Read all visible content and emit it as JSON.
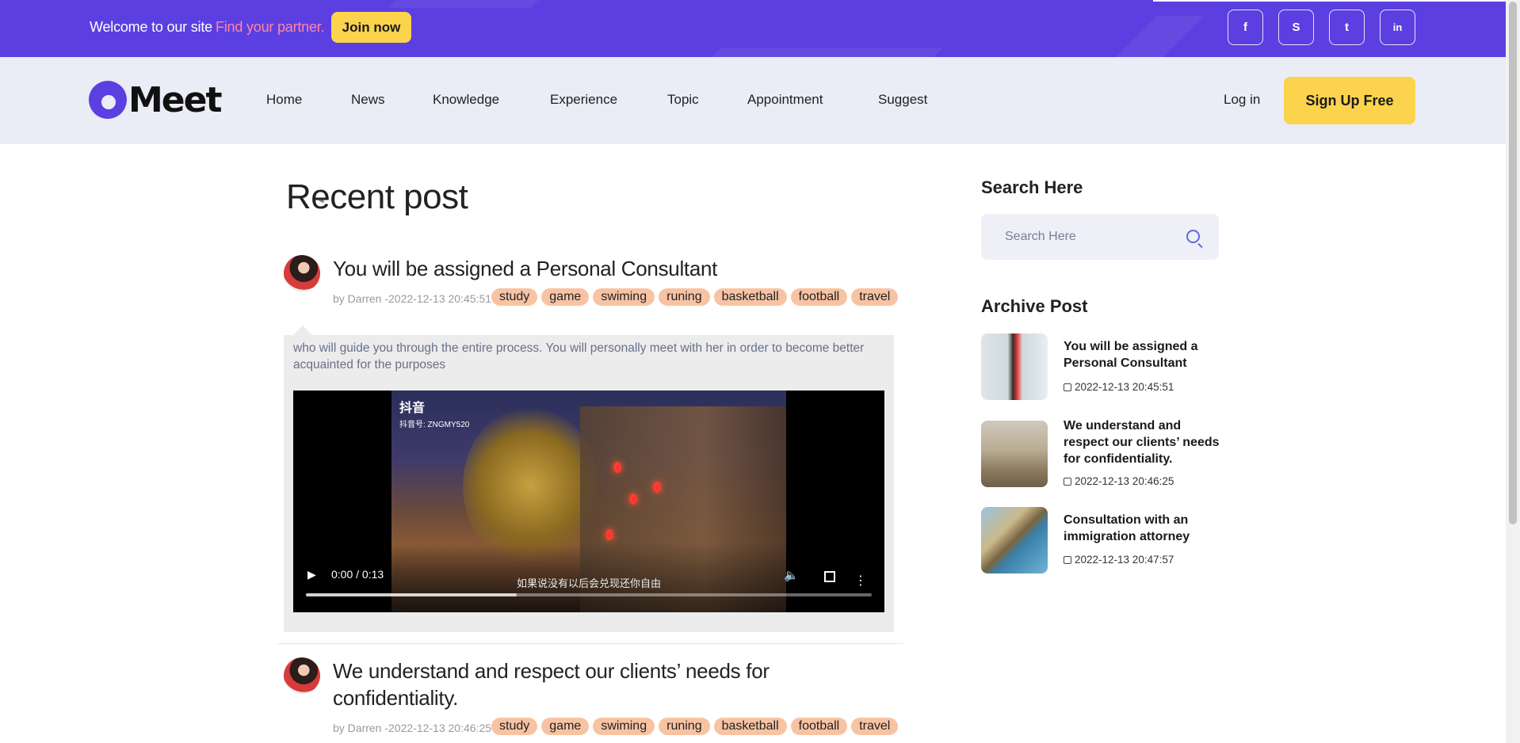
{
  "topbar": {
    "welcome": "Welcome to our site",
    "highlight": "Find your partner.",
    "join_label": "Join now",
    "social": [
      {
        "icon": "facebook-icon",
        "glyph": "f"
      },
      {
        "icon": "skype-icon",
        "glyph": "S"
      },
      {
        "icon": "twitter-icon",
        "glyph": "t"
      },
      {
        "icon": "linkedin-icon",
        "glyph": "in"
      }
    ],
    "colors": {
      "bar": "#5b3fe0",
      "accent": "#ff86a8",
      "button": "#fcd34d"
    }
  },
  "nav": {
    "logo_text": "Meet",
    "items": [
      "Home",
      "News",
      "Knowledge",
      "Experience",
      "Topic",
      "Appointment",
      "Suggest"
    ],
    "login": "Log in",
    "signup": "Sign Up Free"
  },
  "main": {
    "title": "Recent post",
    "posts": [
      {
        "title": "You will be assigned a Personal Consultant",
        "meta": "by Darren -2022-12-13 20:45:51",
        "tags": [
          "study",
          "game",
          "swiming",
          "runing",
          "basketball",
          "football",
          "travel"
        ],
        "excerpt": "who will guide you through the entire process. You will personally meet with her in order to become better acquainted for the purposes",
        "video": {
          "brand": "抖音",
          "brand_sub": "抖音号: ZNGMY520",
          "time": "0:00 / 0:13",
          "subtitle": "如果说没有以后会兑现还你自由"
        }
      },
      {
        "title": "We understand and respect our clients’ needs for confidentiality.",
        "meta": "by Darren -2022-12-13 20:46:25",
        "tags": [
          "study",
          "game",
          "swiming",
          "runing",
          "basketball",
          "football",
          "travel"
        ]
      }
    ]
  },
  "sidebar": {
    "search_heading": "Search Here",
    "search_placeholder": "Search Here",
    "archive_heading": "Archive Post",
    "archive": [
      {
        "title": "You will be assigned a Personal Consultant",
        "date": "2022-12-13 20:45:51"
      },
      {
        "title": "We understand and respect our clients’ needs for confidentiality.",
        "date": "2022-12-13 20:46:25"
      },
      {
        "title": "Consultation with an immigration attorney",
        "date": "2022-12-13 20:47:57"
      }
    ]
  }
}
